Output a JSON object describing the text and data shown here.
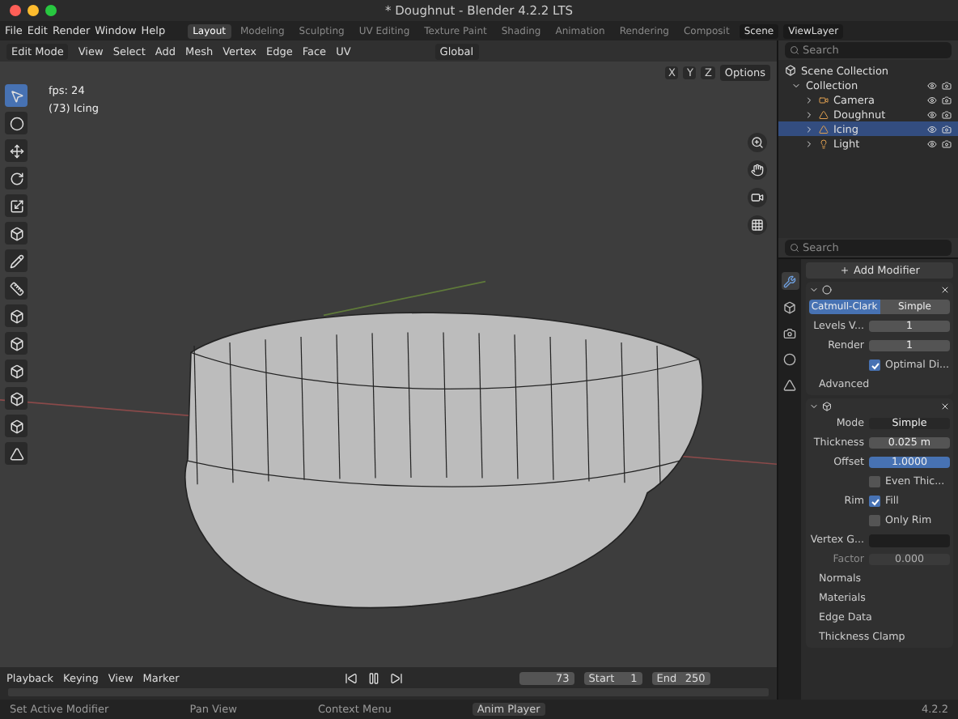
{
  "window": {
    "title": "* Doughnut - Blender 4.2.2 LTS"
  },
  "menu": [
    "File",
    "Edit",
    "Render",
    "Window",
    "Help"
  ],
  "workspaces": [
    {
      "label": "Layout",
      "selected": true
    },
    {
      "label": "Modeling",
      "selected": false
    },
    {
      "label": "Sculpting",
      "selected": false
    },
    {
      "label": "UV Editing",
      "selected": false
    },
    {
      "label": "Texture Paint",
      "selected": false
    },
    {
      "label": "Shading",
      "selected": false
    },
    {
      "label": "Animation",
      "selected": false
    },
    {
      "label": "Rendering",
      "selected": false
    },
    {
      "label": "Composit",
      "selected": false
    }
  ],
  "scene": "Scene",
  "view_layer": "ViewLayer",
  "header": {
    "mode": "Edit Mode",
    "menus": [
      "View",
      "Select",
      "Add",
      "Mesh",
      "Vertex",
      "Edge",
      "Face",
      "UV"
    ],
    "orientation": "Global"
  },
  "viewport": {
    "options": "Options",
    "axes": [
      "X",
      "Y",
      "Z"
    ],
    "overlay": [
      "fps: 24",
      "(73) Icing"
    ]
  },
  "outliner": {
    "search": {
      "placeholder": "Search"
    },
    "root": "Scene Collection",
    "collection": "Collection",
    "items": [
      {
        "name": "Camera",
        "selected": false
      },
      {
        "name": "Doughnut",
        "selected": false
      },
      {
        "name": "Icing",
        "selected": true
      },
      {
        "name": "Light",
        "selected": false
      }
    ]
  },
  "properties": {
    "search": {
      "placeholder": "Search"
    },
    "add_modifier": "Add Modifier",
    "subdivision": {
      "tabs": [
        {
          "label": "Catmull-Clark",
          "selected": true
        },
        {
          "label": "Simple",
          "selected": false
        }
      ],
      "rows": [
        {
          "kind": "field",
          "label": "Levels V...",
          "value": "1",
          "active": false,
          "disabled": false
        },
        {
          "kind": "field",
          "label": "Render",
          "value": "1",
          "active": false,
          "disabled": false
        },
        {
          "kind": "checkbox",
          "text": "Optimal Di...",
          "checked": true
        }
      ],
      "sections": [
        "Advanced"
      ]
    },
    "solidify": {
      "rows": [
        {
          "kind": "select",
          "label": "Mode",
          "value": "Simple"
        },
        {
          "kind": "field",
          "label": "Thickness",
          "value": "0.025 m",
          "active": false,
          "disabled": false
        },
        {
          "kind": "field",
          "label": "Offset",
          "value": "1.0000",
          "active": true,
          "disabled": false
        },
        {
          "kind": "checkbox",
          "text": "Even Thic...",
          "checked": false
        },
        {
          "kind": "checkbox",
          "label": "Rim",
          "text": "Fill",
          "checked": true
        },
        {
          "kind": "checkbox",
          "text": "Only Rim",
          "checked": false
        },
        {
          "kind": "group",
          "label": "Vertex G..."
        },
        {
          "kind": "field",
          "label": "Factor",
          "value": "0.000",
          "active": false,
          "disabled": true
        }
      ],
      "sections": [
        "Normals",
        "Materials",
        "Edge Data",
        "Thickness Clamp"
      ]
    }
  },
  "timeline": {
    "menus": [
      "Playback",
      "Keying",
      "View",
      "Marker"
    ],
    "frame": "73",
    "start_label": "Start",
    "start": "1",
    "end_label": "End",
    "end": "250"
  },
  "status_bar": {
    "hints": [
      "Set Active Modifier",
      "Pan View",
      "Context Menu"
    ],
    "badge": "Anim Player",
    "version": "4.2.2"
  }
}
